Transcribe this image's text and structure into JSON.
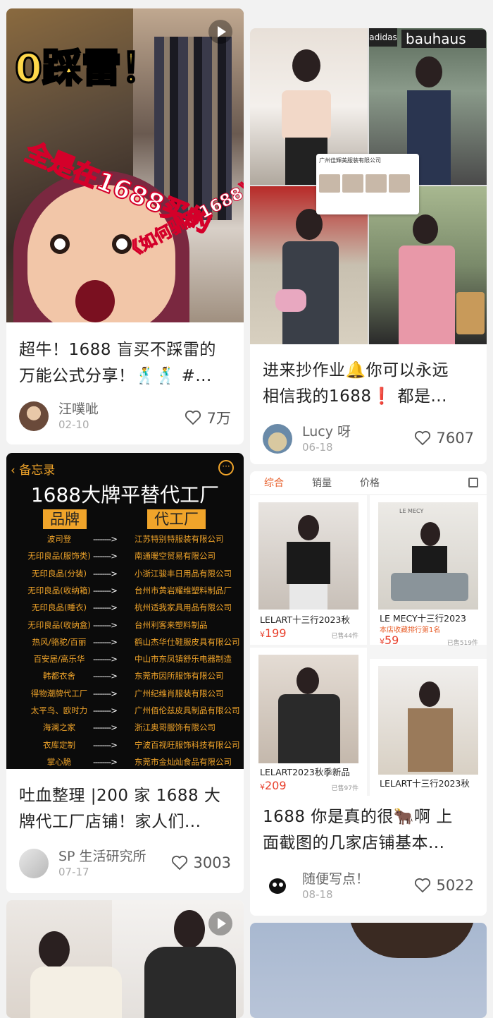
{
  "cards": [
    {
      "cover": {
        "headline": "0踩雷！",
        "slogan": "全是在1688买的",
        "subtitle": "《如何驯服1688》"
      },
      "title_line1": "超牛！1688 盲买不踩雷的",
      "title_line2": "万能公式分享！🕺🕺 #...",
      "author": "汪噗呲",
      "date": "02-10",
      "likes": "7万"
    },
    {
      "cover": {
        "store_names": [
          "adidas",
          "bauhaus"
        ],
        "shop_card_name": "广州佳輝美服装有限公司"
      },
      "title_line1": "进来抄作业🔔你可以永远",
      "title_line2": "相信我的1688❗ 都是...",
      "author": "Lucy 呀",
      "date": "06-18",
      "likes": "7607"
    },
    {
      "cover": {
        "back_label": "备忘录",
        "memo_title": "1688大牌平替代工厂",
        "col_brand": "品牌",
        "col_factory": "代工厂",
        "arrow": "-------->",
        "rows": [
          {
            "brand": "波司登",
            "factory": "江苏特别特服装有限公司"
          },
          {
            "brand": "无印良品(服饰类)",
            "factory": "南通暖空贸易有限公司"
          },
          {
            "brand": "无印良品(分装)",
            "factory": "小浙江骏丰日用品有限公司"
          },
          {
            "brand": "无印良品(收纳箱)",
            "factory": "台州市黄岩耀维塑料制品厂"
          },
          {
            "brand": "无印良品(睡衣)",
            "factory": "杭州适我家具用品有限公司"
          },
          {
            "brand": "无印良品(收纳盒)",
            "factory": "台州利客来塑料制品"
          },
          {
            "brand": "热风/骆驼/百丽",
            "factory": "鹤山杰华仕鞋服皮具有限公司"
          },
          {
            "brand": "百安居/高乐华",
            "factory": "中山市东凤镇舒乐电器制造"
          },
          {
            "brand": "韩都衣舍",
            "factory": "东莞市因所服饰有限公司"
          },
          {
            "brand": "得物潮牌代工厂",
            "factory": "广州纪维肖服装有限公司"
          },
          {
            "brand": "太平鸟、欧时力",
            "factory": "广州佰伦兹皮具制品有限公司"
          },
          {
            "brand": "海澜之家",
            "factory": "浙江奥哥服饰有限公司"
          },
          {
            "brand": "衣库定制",
            "factory": "宁波百视旺服饰科技有限公司"
          },
          {
            "brand": "掌心脆",
            "factory": "东莞市金灿灿食品有限公司"
          }
        ]
      },
      "title_line1": "吐血整理 |200 家 1688 大",
      "title_line2": "牌代工厂店铺！家人们...",
      "author": "SP 生活研究所",
      "date": "07-17",
      "likes": "3003"
    },
    {
      "cover": {
        "tabs": [
          "综合",
          "销量",
          "价格"
        ],
        "products": [
          {
            "name": "LELART十三行2023秋",
            "price_symbol": "¥",
            "price": "199",
            "sold": "已售44件",
            "rank": ""
          },
          {
            "name": "LE MECY十三行2023",
            "price_symbol": "¥",
            "price": "59",
            "sold": "已售519件",
            "rank": "本店收藏排行第1名",
            "brand_mark": "LE MECY"
          },
          {
            "name": "LELART2023秋季新品",
            "price_symbol": "¥",
            "price": "209",
            "sold": "已售97件",
            "rank": ""
          },
          {
            "name": "LELART十三行2023秋",
            "price_symbol": "",
            "price": "",
            "sold": "",
            "rank": ""
          }
        ]
      },
      "title_line1": "1688 你是真的很🐂啊 上",
      "title_line2": "面截图的几家店铺基本...",
      "author": "随便写点！",
      "date": "08-18",
      "likes": "5022"
    }
  ],
  "colors": {
    "background": "#f2f2f2",
    "accent_orange": "#f0a42a",
    "price_red": "#e8402c",
    "headline_yellow": "#ffd84a"
  }
}
